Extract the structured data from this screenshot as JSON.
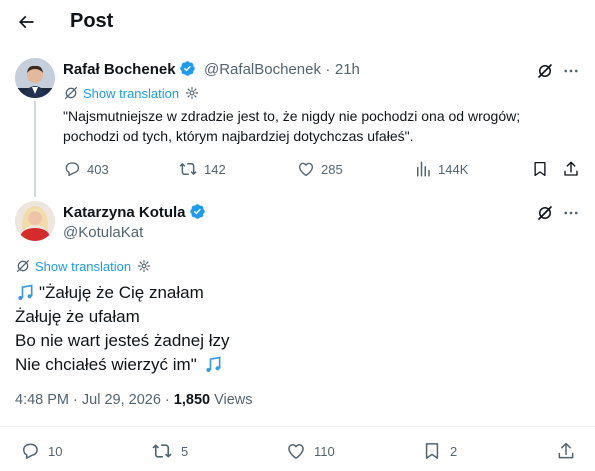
{
  "header": {
    "title": "Post"
  },
  "tweet1": {
    "author_name": "Rafał Bochenek",
    "handle": "@RafalBochenek",
    "dot": "·",
    "time": "21h",
    "show_translation": "Show translation",
    "text_line1": "\"Najsmutniejsze w zdradzie jest to, że nigdy nie pochodzi ona od wrogów;",
    "text_line2": "pochodzi od tych, którym najbardziej dotychczas ufałeś\".",
    "replies": "403",
    "reposts": "142",
    "likes": "285",
    "views": "144K"
  },
  "tweet2": {
    "author_name": "Katarzyna Kotula",
    "handle": "@KotulaKat",
    "show_translation": "Show translation",
    "line1": "\"Żałuję że Cię znałam",
    "line2": "Żałuję że ufałam",
    "line3": "Bo nie wart jesteś żadnej łzy",
    "line4": "Nie chciałeś wierzyć im\"",
    "timestamp": "4:48 PM · Jul 29, 2026 · ",
    "views_count": "1,850",
    "views_label": " Views",
    "replies": "10",
    "reposts": "5",
    "likes": "110",
    "bookmarks": "2"
  },
  "colors": {
    "accent": "#1d9bf0",
    "muted": "#536471",
    "text": "#0f1419"
  }
}
